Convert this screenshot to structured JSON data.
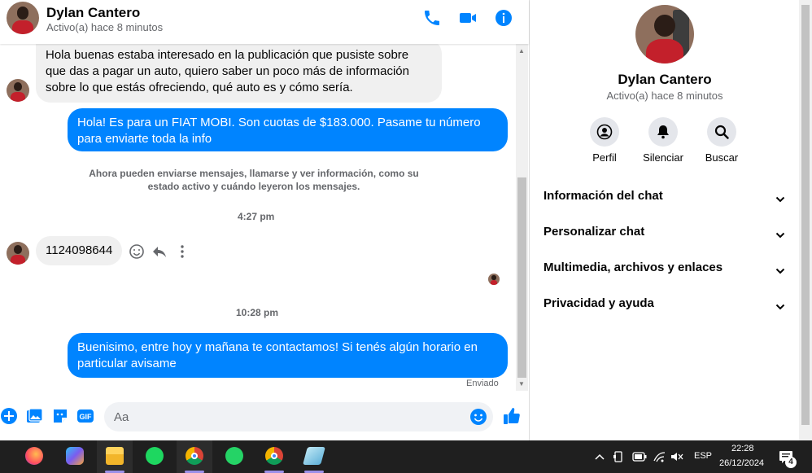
{
  "header": {
    "name": "Dylan Cantero",
    "status": "Activo(a) hace 8 minutos"
  },
  "messages": {
    "incoming_1": "Hola buenas estaba interesado en la publicación  que pusiste sobre que das a pagar un auto, quiero saber un poco más de información sobre lo que estás ofreciendo, qué auto es y cómo sería.",
    "outgoing_1": "Hola! Es para un FIAT MOBI. Son cuotas de $183.000. Pasame tu número para enviarte toda la info",
    "system_notice": "Ahora pueden enviarse mensajes, llamarse y ver información, como su estado activo y cuándo leyeron los mensajes.",
    "time_1": "4:27 pm",
    "incoming_2": "1124098644",
    "time_2": "10:28 pm",
    "outgoing_2": "Buenisimo, entre hoy y mañana te contactamos! Si tenés algún horario en particular avisame",
    "sent_status": "Enviado"
  },
  "composer": {
    "placeholder": "Aa"
  },
  "panel": {
    "name": "Dylan Cantero",
    "status": "Activo(a) hace 8 minutos",
    "actions": [
      {
        "label": "Perfil",
        "icon": "profile-icon"
      },
      {
        "label": "Silenciar",
        "icon": "bell-icon"
      },
      {
        "label": "Buscar",
        "icon": "search-icon"
      }
    ],
    "sections": [
      "Información del chat",
      "Personalizar chat",
      "Multimedia, archivos y enlaces",
      "Privacidad y ayuda"
    ]
  },
  "taskbar": {
    "language": "ESP",
    "time": "22:28",
    "date": "26/12/2024",
    "notifications": "4",
    "apps": [
      "firefox-icon",
      "copilot-icon",
      "file-explorer-icon",
      "spotify-icon",
      "chrome-icon",
      "whatsapp-icon",
      "chrome-profile-icon",
      "notes-icon"
    ]
  },
  "colors": {
    "accent": "#0084ff",
    "incoming_bubble": "#f0f0f0",
    "taskbar": "#1f1f1f"
  }
}
